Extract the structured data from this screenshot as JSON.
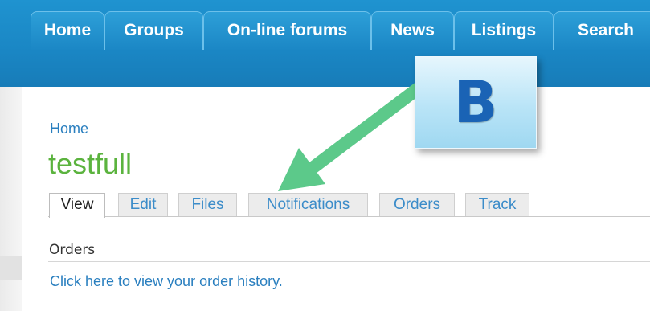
{
  "nav": {
    "items": [
      {
        "label": "Home"
      },
      {
        "label": "Groups"
      },
      {
        "label": "On-line forums"
      },
      {
        "label": "News"
      },
      {
        "label": "Listings"
      },
      {
        "label": "Search"
      }
    ]
  },
  "breadcrumb": {
    "label": "Home"
  },
  "page": {
    "title": "testfull"
  },
  "tabs": [
    {
      "label": "View"
    },
    {
      "label": "Edit"
    },
    {
      "label": "Files"
    },
    {
      "label": "Notifications"
    },
    {
      "label": "Orders"
    },
    {
      "label": "Track"
    }
  ],
  "orders": {
    "title": "Orders",
    "link": "Click here to view your order history."
  },
  "annotation": {
    "badge_letter": "B",
    "arrow_color": "#5cc98a",
    "badge_color": "#b9e4f7"
  },
  "colors": {
    "header": "#1a86c4",
    "title": "#5bb33e",
    "link": "#2a7fbf"
  }
}
